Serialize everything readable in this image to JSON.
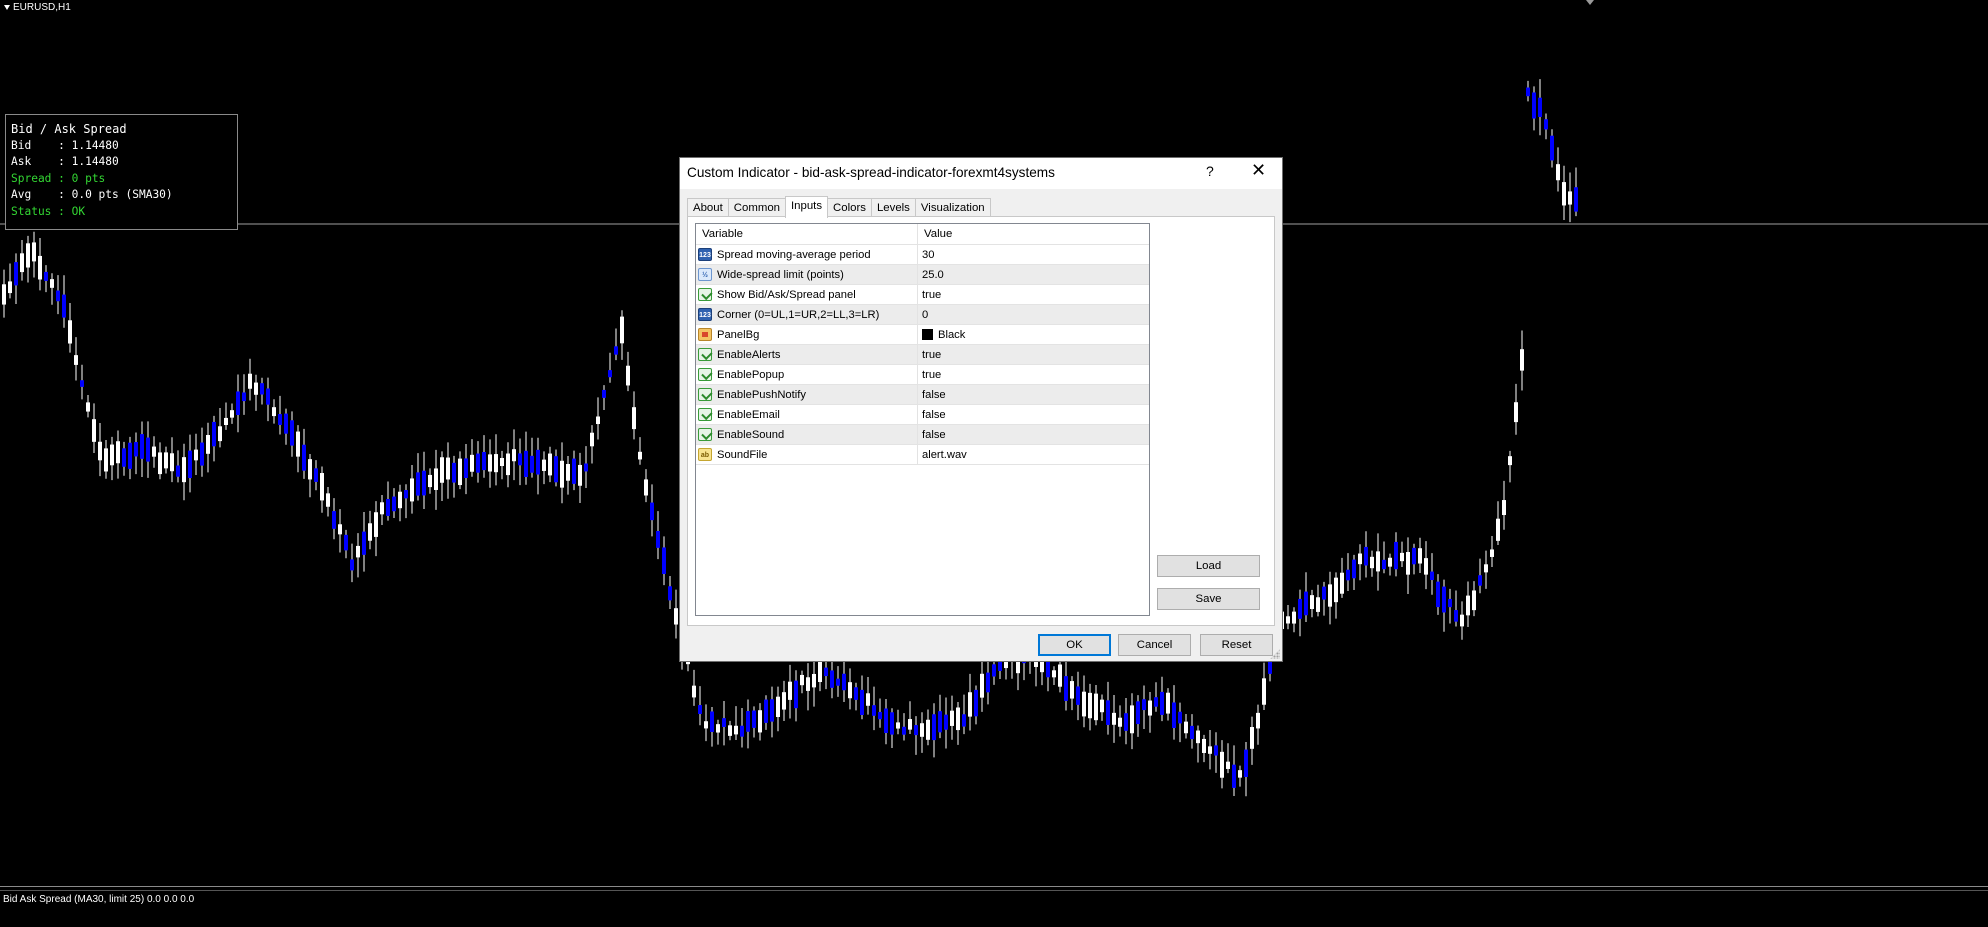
{
  "chart": {
    "symbol": "EURUSD,H1",
    "colors": {
      "background": "#000000",
      "bull_candle": "#ffffff",
      "bear_candle": "#0000ff",
      "wick": "#ffffff",
      "bid_line": "#a0a0a0"
    }
  },
  "info_panel": {
    "title": "Bid / Ask Spread",
    "bid": "Bid    : 1.14480",
    "ask": "Ask    : 1.14480",
    "spread": "Spread : 0 pts",
    "avg": "Avg    : 0.0 pts (SMA30)",
    "status": "Status : OK"
  },
  "status_bar": {
    "text": "Bid Ask Spread (MA30, limit 25) 0.0 0.0 0.0"
  },
  "dialog": {
    "title": "Custom Indicator - bid-ask-spread-indicator-forexmt4systems",
    "help": "?",
    "close": "✕",
    "tabs": [
      "About",
      "Common",
      "Inputs",
      "Colors",
      "Levels",
      "Visualization"
    ],
    "active_tab": "Inputs",
    "columns": {
      "variable": "Variable",
      "value": "Value"
    },
    "params": [
      {
        "icon": "int-icon",
        "name": "Spread moving-average period",
        "value": "30"
      },
      {
        "icon": "double-icon",
        "name": "Wide-spread limit (points)",
        "value": "25.0"
      },
      {
        "icon": "bool-icon",
        "name": "Show Bid/Ask/Spread panel",
        "value": "true"
      },
      {
        "icon": "int-icon",
        "name": "Corner (0=UL,1=UR,2=LL,3=LR)",
        "value": "0"
      },
      {
        "icon": "color-icon",
        "name": "PanelBg",
        "value": "Black"
      },
      {
        "icon": "bool-icon",
        "name": "EnableAlerts",
        "value": "true"
      },
      {
        "icon": "bool-icon",
        "name": "EnablePopup",
        "value": "true"
      },
      {
        "icon": "bool-icon",
        "name": "EnablePushNotify",
        "value": "false"
      },
      {
        "icon": "bool-icon",
        "name": "EnableEmail",
        "value": "false"
      },
      {
        "icon": "bool-icon",
        "name": "EnableSound",
        "value": "false"
      },
      {
        "icon": "string-icon",
        "name": "SoundFile",
        "value": "alert.wav"
      }
    ],
    "buttons": {
      "load": "Load",
      "save": "Save",
      "ok": "OK",
      "cancel": "Cancel",
      "reset": "Reset"
    },
    "icon_glyphs": {
      "int": "123",
      "double": "½",
      "string": "ab"
    }
  }
}
